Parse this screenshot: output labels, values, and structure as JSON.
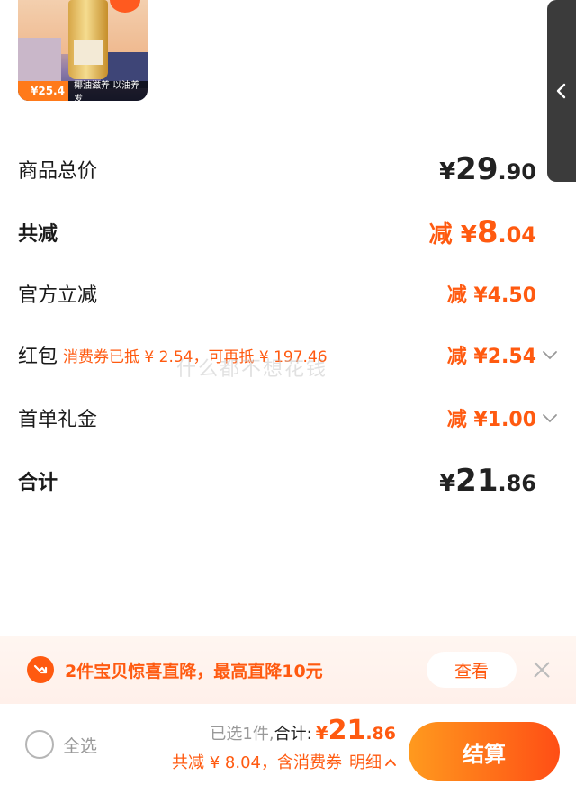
{
  "product": {
    "price_tag": "¥25.4",
    "slogan": "椰油滋养 以油养发"
  },
  "summary_rows": {
    "goods_total": {
      "label": "商品总价",
      "yen": "¥",
      "int": "29",
      "dec": ".90"
    },
    "total_discount": {
      "label": "共减",
      "prefix": "减 ¥",
      "int": "8",
      "dec": ".04"
    },
    "official": {
      "label": "官方立减",
      "value": "减 ¥4.50"
    },
    "red_packet": {
      "label": "红包",
      "note": "消费券已抵 ¥ 2.54，可再抵 ¥ 197.46",
      "value": "减 ¥2.54"
    },
    "first_order": {
      "label": "首单礼金",
      "value": "减 ¥1.00"
    },
    "total": {
      "label": "合计",
      "yen": "¥",
      "int": "21",
      "dec": ".86"
    }
  },
  "watermark": "什么都不想花钱",
  "promo": {
    "text": "2件宝贝惊喜直降，最高直降10元",
    "button": "查看"
  },
  "bottom_bar": {
    "select_all": "全选",
    "selected_count": "已选1件,",
    "total_label": "合计:",
    "total_yen": "¥",
    "total_int": "21",
    "total_dec": ".86",
    "discount_note": "共减 ¥ 8.04，含消费券",
    "detail": "明细",
    "checkout": "结算"
  },
  "colors": {
    "accent": "#ff5a10",
    "checkout_gradient_start": "#ff9a1e",
    "checkout_gradient_end": "#ff4e15"
  },
  "icons": {
    "side_tab": "chevron-left-icon",
    "row_expand": "chevron-down-icon",
    "promo": "price-down-icon",
    "close": "close-icon",
    "detail": "chevron-up-icon"
  }
}
